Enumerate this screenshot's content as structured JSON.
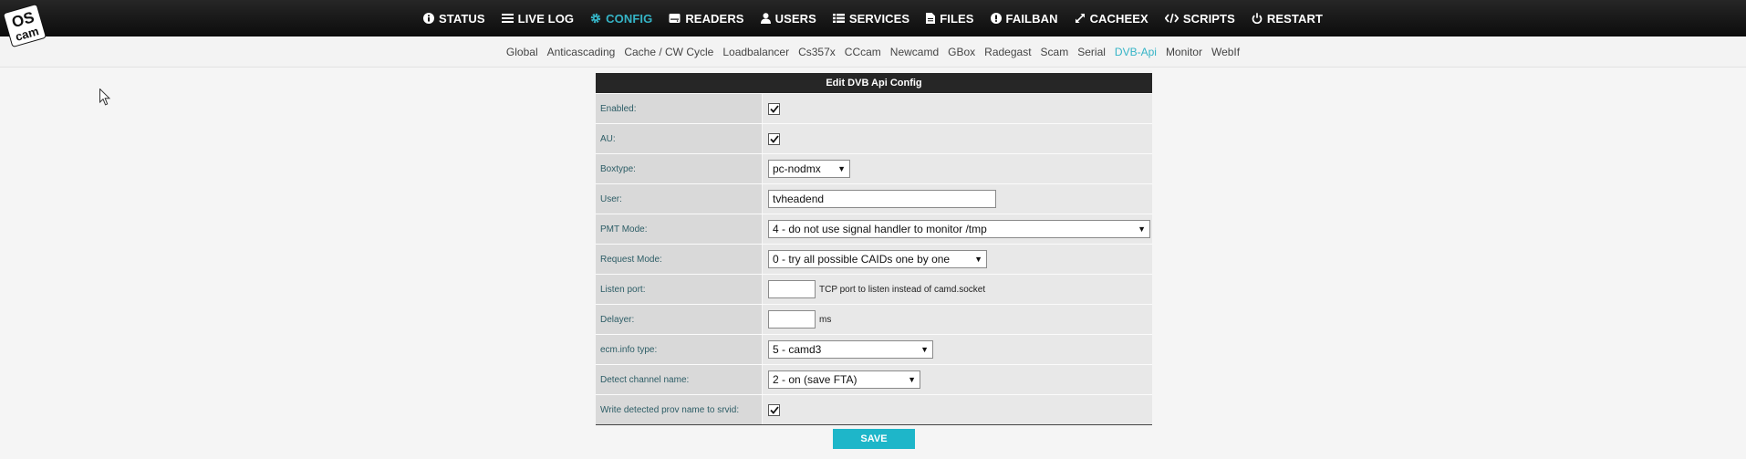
{
  "logo": {
    "line1": "OS",
    "line2": "cam"
  },
  "main_nav": [
    {
      "label": "STATUS",
      "icon": "info-icon"
    },
    {
      "label": "LIVE LOG",
      "icon": "list-icon"
    },
    {
      "label": "CONFIG",
      "icon": "gear-icon",
      "active": true
    },
    {
      "label": "READERS",
      "icon": "hdd-icon"
    },
    {
      "label": "USERS",
      "icon": "user-icon"
    },
    {
      "label": "SERVICES",
      "icon": "table-list-icon"
    },
    {
      "label": "FILES",
      "icon": "file-icon"
    },
    {
      "label": "FAILBAN",
      "icon": "exclamation-icon"
    },
    {
      "label": "CACHEEX",
      "icon": "expand-icon"
    },
    {
      "label": "SCRIPTS",
      "icon": "code-icon"
    },
    {
      "label": "RESTART",
      "icon": "power-icon"
    }
  ],
  "sub_nav": [
    "Global",
    "Anticascading",
    "Cache / CW Cycle",
    "Loadbalancer",
    "Cs357x",
    "CCcam",
    "Newcamd",
    "GBox",
    "Radegast",
    "Scam",
    "Serial",
    "DVB-Api",
    "Monitor",
    "WebIf"
  ],
  "sub_nav_active": "DVB-Api",
  "form": {
    "title": "Edit DVB Api Config",
    "enabled": {
      "label": "Enabled:",
      "checked": true
    },
    "au": {
      "label": "AU:",
      "checked": true
    },
    "boxtype": {
      "label": "Boxtype:",
      "value": "pc-nodmx"
    },
    "user": {
      "label": "User:",
      "value": "tvheadend"
    },
    "pmt_mode": {
      "label": "PMT Mode:",
      "value": "4 - do not use signal handler to monitor /tmp"
    },
    "request_mode": {
      "label": "Request Mode:",
      "value": "0 - try all possible CAIDs one by one"
    },
    "listen_port": {
      "label": "Listen port:",
      "value": "",
      "hint": "TCP port to listen instead of camd.socket"
    },
    "delayer": {
      "label": "Delayer:",
      "value": "",
      "unit": "ms"
    },
    "ecm_info": {
      "label": "ecm.info type:",
      "value": "5 - camd3"
    },
    "detect_channel": {
      "label": "Detect channel name:",
      "value": "2 - on (save FTA)"
    },
    "write_prov": {
      "label": "Write detected prov name to srvid:",
      "checked": true
    }
  },
  "save_label": "SAVE",
  "colors": {
    "accent": "#35b4c6",
    "bar": "#111111",
    "save": "#1eb6c9"
  }
}
